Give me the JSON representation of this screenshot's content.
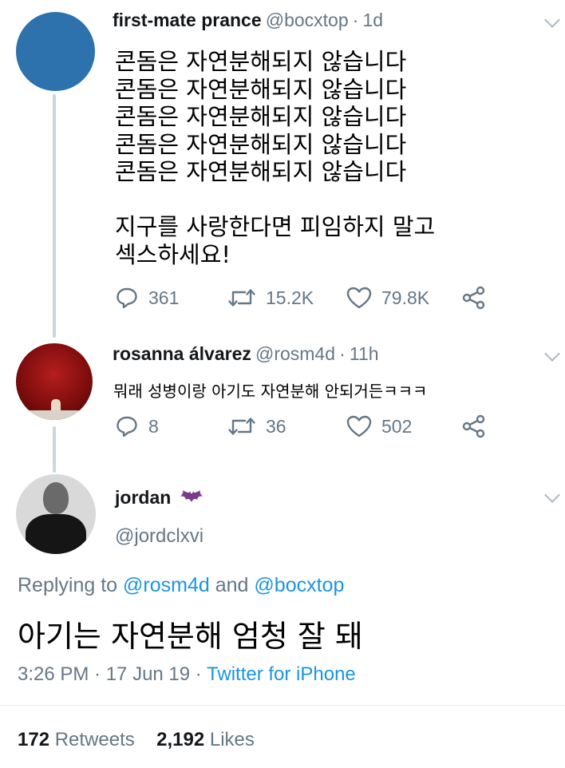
{
  "tweets": [
    {
      "display_name": "first-mate prance",
      "handle": "@bocxtop",
      "time": "1d",
      "avatar_color": "#2d72ad",
      "text_lines": [
        "콘돔은 자연분해되지 않습니다",
        "콘돔은 자연분해되지 않습니다",
        "콘돔은 자연분해되지 않습니다",
        "콘돔은 자연분해되지 않습니다",
        "콘돔은 자연분해되지 않습니다",
        "",
        "지구를 사랑한다면 피임하지 말고",
        "섹스하세요!"
      ],
      "actions": {
        "replies": "361",
        "retweets": "15.2K",
        "likes": "79.8K"
      }
    },
    {
      "display_name": "rosanna álvarez",
      "handle": "@rosm4d",
      "time": "11h",
      "text": "뭐래 성병이랑 아기도 자연분해 안되거든ㅋㅋㅋ",
      "actions": {
        "replies": "8",
        "retweets": "36",
        "likes": "502"
      }
    }
  ],
  "main_tweet": {
    "display_name": "jordan",
    "handle": "@jordclxvi",
    "replying_prefix": "Replying to",
    "mention1": "@rosm4d",
    "and_word": "and",
    "mention2": "@bocxtop",
    "text": "아기는 자연분해 엄청 잘 돼",
    "timestamp": "3:26 PM · 17 Jun 19 ·",
    "source": "Twitter for iPhone",
    "retweet_count": "172",
    "retweet_label": "Retweets",
    "like_count": "2,192",
    "like_label": "Likes"
  },
  "colors": {
    "link_blue": "#1b95e0",
    "meta_gray": "#657786",
    "thread_line": "#ccd6dd"
  }
}
